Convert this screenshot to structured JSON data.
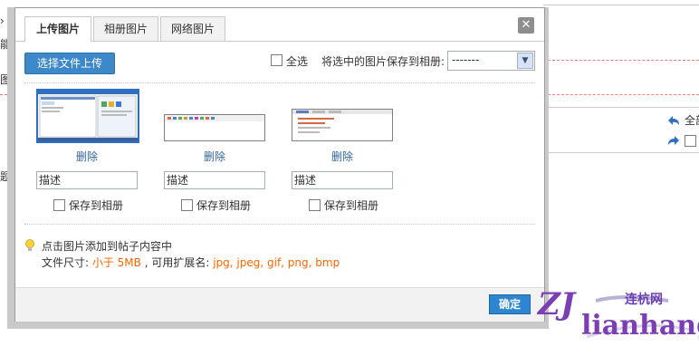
{
  "background": {
    "fragments": [
      "› 帖",
      "能?",
      "图片",
      "题面",
      "全部"
    ]
  },
  "dialog": {
    "tabs": [
      "上传图片",
      "相册图片",
      "网络图片"
    ],
    "active_tab": 0,
    "close_symbol": "✕",
    "upload_button": "选择文件上传",
    "select_all_label": "全选",
    "save_selected_label": "将选中的图片保存到相册:",
    "album_select_value": "-------",
    "images": [
      {
        "delete_label": "删除",
        "description_placeholder": "描述",
        "save_label": "保存到相册",
        "selected": true
      },
      {
        "delete_label": "删除",
        "description_placeholder": "描述",
        "save_label": "保存到相册",
        "selected": false
      },
      {
        "delete_label": "删除",
        "description_placeholder": "描述",
        "save_label": "保存到相册",
        "selected": false
      }
    ],
    "tip_line1": "点击图片添加到帖子内容中",
    "tip_size_prefix": "文件尺寸: ",
    "tip_size_value": "小于 5MB",
    "tip_ext_prefix": " , 可用扩展名: ",
    "tip_ext_value": "jpg, jpeg, gif, png, bmp",
    "ok_button": "确定"
  },
  "watermark": {
    "logo": "ZJ",
    "brand": "lianhang",
    "chinese": "连杭网"
  },
  "colors": {
    "accent": "#3d88c8",
    "link": "#336699",
    "highlight": "#ff6600",
    "watermark": "#7b3fb3"
  }
}
